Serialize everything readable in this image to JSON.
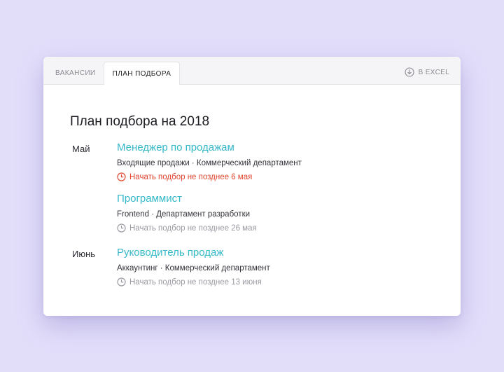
{
  "tabs": [
    {
      "label": "ВАКАНСИИ",
      "active": false
    },
    {
      "label": "ПЛАН ПОДБОРА",
      "active": true
    }
  ],
  "export": {
    "label": "В EXCEL",
    "icon": "download-icon"
  },
  "title": "План подбора на 2018",
  "months": [
    {
      "label": "Май"
    },
    {
      "label": "Июнь"
    }
  ],
  "jobs": [
    {
      "title": "Менеджер по продажам",
      "dept": "Входящие продажи · Коммерческий департамент",
      "deadline": "Начать подбор не позднее 6 мая",
      "urgent": true
    },
    {
      "title": "Программист",
      "dept": "Frontend  ·  Департамент разработки",
      "deadline": "Начать подбор не позднее 26 мая",
      "urgent": false
    },
    {
      "title": "Руководитель продаж",
      "dept": "Аккаунтинг · Коммерческий департамент",
      "deadline": "Начать подбор не позднее 13 июня",
      "urgent": false
    }
  ],
  "colors": {
    "background": "#e2defa",
    "accent": "#35b8c8",
    "urgent": "#e0452f",
    "muted": "#9a9aa3"
  }
}
